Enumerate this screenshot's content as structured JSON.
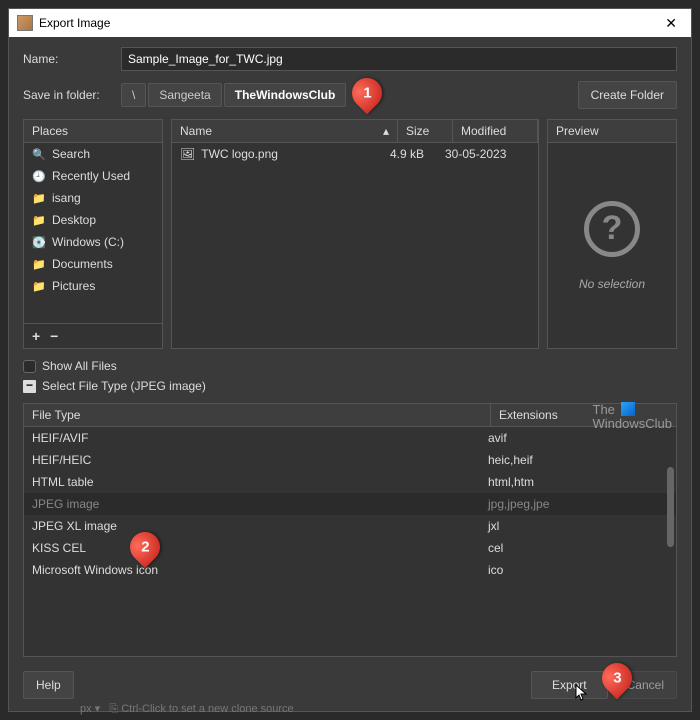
{
  "window": {
    "title": "Export Image"
  },
  "name": {
    "label": "Name:",
    "value": "Sample_Image_for_TWC.jpg"
  },
  "folder": {
    "label": "Save in folder:",
    "crumbs": [
      "\\",
      "Sangeeta",
      "TheWindowsClub"
    ],
    "create_btn": "Create Folder"
  },
  "places": {
    "header": "Places",
    "items": [
      {
        "icon": "🔍",
        "label": "Search"
      },
      {
        "icon": "🕘",
        "label": "Recently Used"
      },
      {
        "icon": "📁",
        "label": "isang"
      },
      {
        "icon": "📁",
        "label": "Desktop"
      },
      {
        "icon": "💽",
        "label": "Windows (C:)"
      },
      {
        "icon": "📁",
        "label": "Documents"
      },
      {
        "icon": "📁",
        "label": "Pictures"
      }
    ],
    "add": "+",
    "remove": "−"
  },
  "filelist": {
    "headers": {
      "name": "Name",
      "size": "Size",
      "modified": "Modified"
    },
    "rows": [
      {
        "icon": "🖼",
        "name": "TWC logo.png",
        "size": "4.9 kB",
        "modified": "30-05-2023"
      }
    ]
  },
  "preview": {
    "header": "Preview",
    "mark": "?",
    "text": "No selection"
  },
  "show_all": "Show All Files",
  "file_type_expander": "Select File Type (JPEG image)",
  "types": {
    "headers": {
      "type": "File Type",
      "ext": "Extensions"
    },
    "rows": [
      {
        "type": "HEIF/AVIF",
        "ext": "avif",
        "sel": false
      },
      {
        "type": "HEIF/HEIC",
        "ext": "heic,heif",
        "sel": false
      },
      {
        "type": "HTML table",
        "ext": "html,htm",
        "sel": false
      },
      {
        "type": "JPEG image",
        "ext": "jpg,jpeg,jpe",
        "sel": true
      },
      {
        "type": "JPEG XL image",
        "ext": "jxl",
        "sel": false
      },
      {
        "type": "KISS CEL",
        "ext": "cel",
        "sel": false
      },
      {
        "type": "Microsoft Windows icon",
        "ext": "ico",
        "sel": false
      }
    ]
  },
  "footer": {
    "help": "Help",
    "export": "Export",
    "cancel": "Cancel"
  },
  "watermark": {
    "line1": "The",
    "line2": "WindowsClub"
  },
  "callouts": {
    "1": "1",
    "2": "2",
    "3": "3"
  },
  "status": "Ctrl-Click to set a new clone source"
}
